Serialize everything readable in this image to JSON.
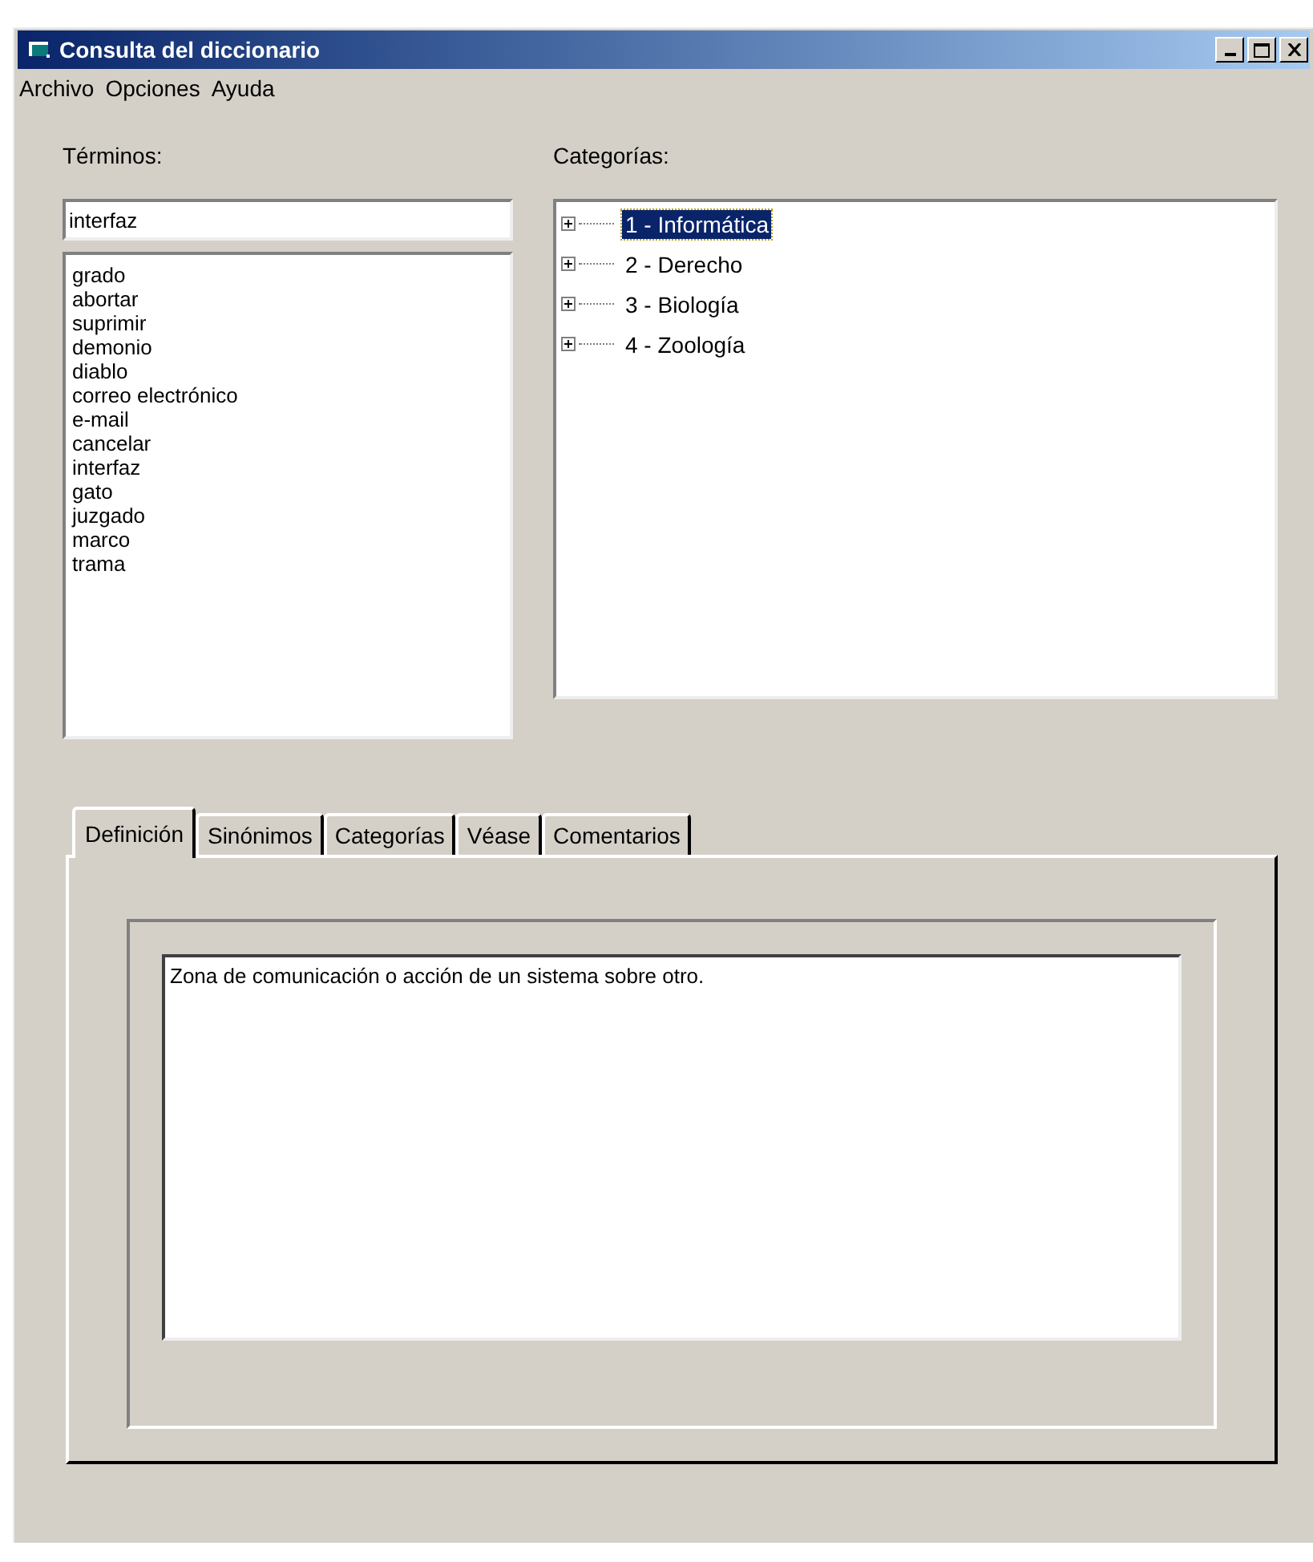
{
  "window": {
    "title": "Consulta del diccionario"
  },
  "menu": [
    "Archivo",
    "Opciones",
    "Ayuda"
  ],
  "terms": {
    "label": "Términos:",
    "value": "interfaz",
    "items": [
      "grado",
      "abortar",
      "suprimir",
      "demonio",
      "diablo",
      "correo electrónico",
      "e-mail",
      "cancelar",
      "interfaz",
      "gato",
      "juzgado",
      "marco",
      "trama"
    ]
  },
  "categories": {
    "label": "Categorías:",
    "items": [
      {
        "label": "1 - Informática",
        "selected": true,
        "expanded": false
      },
      {
        "label": "2 - Derecho",
        "selected": false,
        "expanded": false
      },
      {
        "label": "3 - Biología",
        "selected": false,
        "expanded": false
      },
      {
        "label": "4 - Zoología",
        "selected": false,
        "expanded": false
      }
    ]
  },
  "tabs": [
    {
      "label": "Definición",
      "selected": true
    },
    {
      "label": "Sinónimos",
      "selected": false
    },
    {
      "label": "Categorías",
      "selected": false
    },
    {
      "label": "Véase",
      "selected": false
    },
    {
      "label": "Comentarios",
      "selected": false
    }
  ],
  "definition": "Zona de comunicación o acción de un sistema sobre otro."
}
